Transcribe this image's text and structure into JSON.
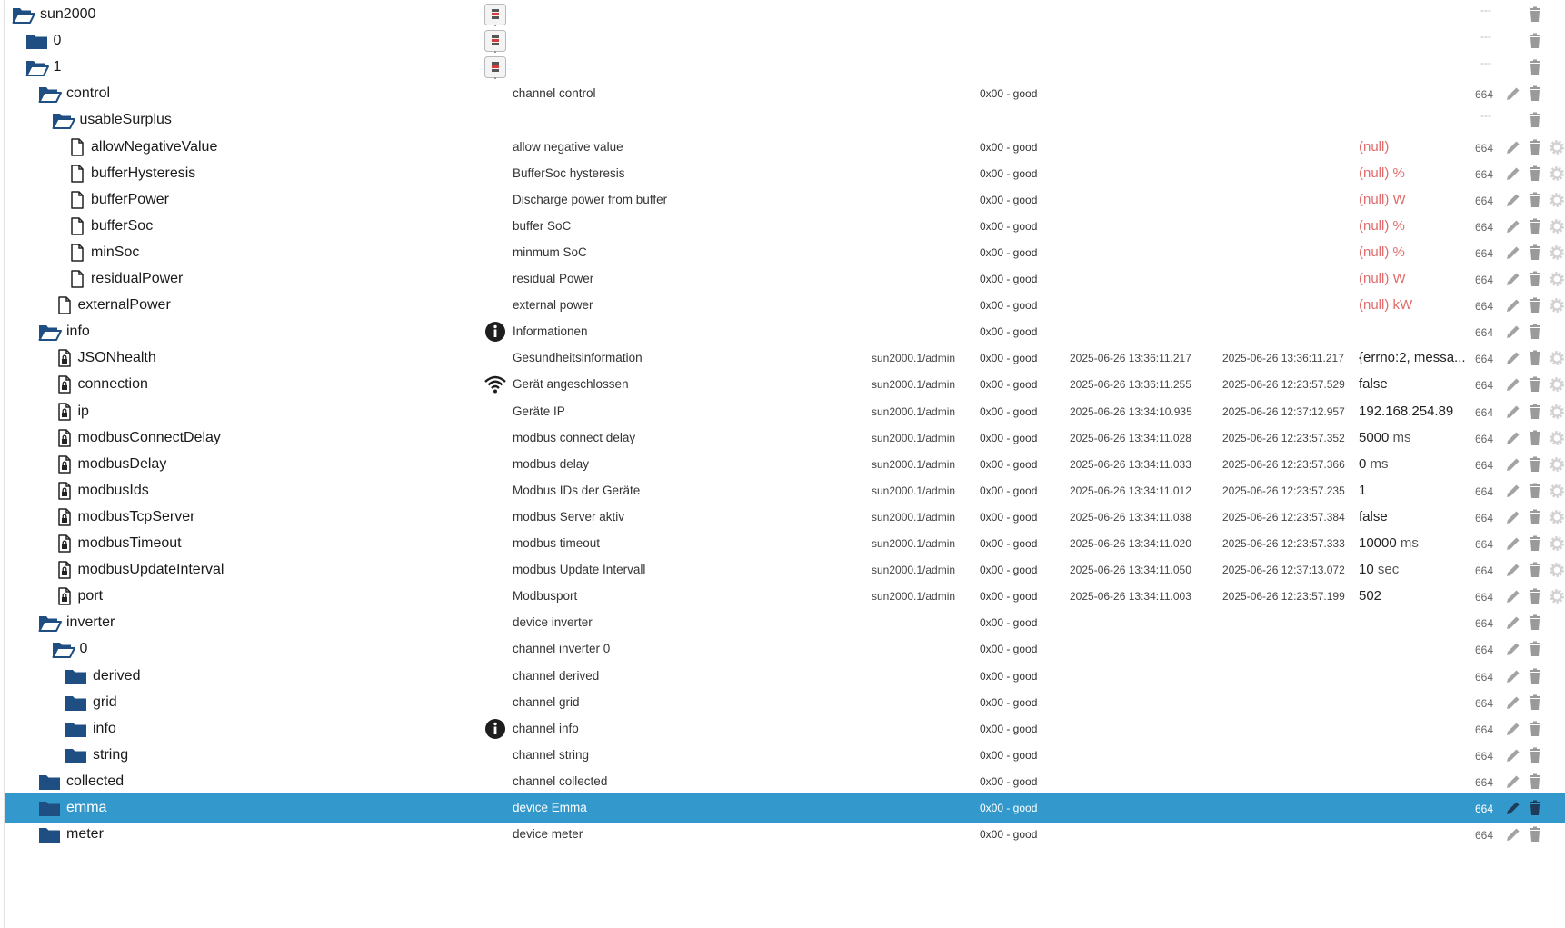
{
  "colors": {
    "folder": "#1f4f82",
    "selection": "#3399cc",
    "null_value": "#e06b6b"
  },
  "rows": [
    {
      "name": "sun2000",
      "indent": 0,
      "type": "folder-open",
      "mid_icon": "device-logo",
      "acl": "---"
    },
    {
      "name": "0",
      "indent": 1,
      "type": "folder",
      "mid_icon": "device-logo",
      "acl": "---"
    },
    {
      "name": "1",
      "indent": 1,
      "type": "folder-open",
      "mid_icon": "device-logo",
      "acl": "---"
    },
    {
      "name": "control",
      "indent": 2,
      "type": "folder-open",
      "desc": "channel control",
      "quality": "0x00 - good",
      "acl": "664"
    },
    {
      "name": "usableSurplus",
      "indent": 3,
      "type": "folder-open",
      "acl": "---"
    },
    {
      "name": "allowNegativeValue",
      "indent": 4,
      "type": "file",
      "desc": "allow negative value",
      "quality": "0x00 - good",
      "value": "(null)",
      "unit": "",
      "acl": "664",
      "gear": true
    },
    {
      "name": "bufferHysteresis",
      "indent": 4,
      "type": "file",
      "desc": "BufferSoc hysteresis",
      "quality": "0x00 - good",
      "value": "(null)",
      "unit": "%",
      "acl": "664",
      "gear": true
    },
    {
      "name": "bufferPower",
      "indent": 4,
      "type": "file",
      "desc": "Discharge power from buffer",
      "quality": "0x00 - good",
      "value": "(null)",
      "unit": "W",
      "acl": "664",
      "gear": true
    },
    {
      "name": "bufferSoc",
      "indent": 4,
      "type": "file",
      "desc": "buffer SoC",
      "quality": "0x00 - good",
      "value": "(null)",
      "unit": "%",
      "acl": "664",
      "gear": true
    },
    {
      "name": "minSoc",
      "indent": 4,
      "type": "file",
      "desc": "minmum SoC",
      "quality": "0x00 - good",
      "value": "(null)",
      "unit": "%",
      "acl": "664",
      "gear": true
    },
    {
      "name": "residualPower",
      "indent": 4,
      "type": "file",
      "desc": "residual Power",
      "quality": "0x00 - good",
      "value": "(null)",
      "unit": "W",
      "acl": "664",
      "gear": true
    },
    {
      "name": "externalPower",
      "indent": 3,
      "type": "file",
      "desc": "external power",
      "quality": "0x00 - good",
      "value": "(null)",
      "unit": "kW",
      "acl": "664",
      "gear": true
    },
    {
      "name": "info",
      "indent": 2,
      "type": "folder-open",
      "mid_icon": "info-icon",
      "desc": "Informationen",
      "quality": "0x00 - good",
      "acl": "664"
    },
    {
      "name": "JSONhealth",
      "indent": 3,
      "type": "file-lock",
      "desc": "Gesundheitsinformation",
      "user": "sun2000.1/admin",
      "quality": "0x00 - good",
      "ts": "2025-06-26 13:36:11.217",
      "lc": "2025-06-26 13:36:11.217",
      "value": "{errno:2, messa...",
      "unit": "",
      "acl": "664",
      "gear": true
    },
    {
      "name": "connection",
      "indent": 3,
      "type": "file-lock",
      "mid_icon": "wifi-icon",
      "desc": "Gerät angeschlossen",
      "user": "sun2000.1/admin",
      "quality": "0x00 - good",
      "ts": "2025-06-26 13:36:11.255",
      "lc": "2025-06-26 12:23:57.529",
      "value": "false",
      "unit": "",
      "acl": "664",
      "gear": true
    },
    {
      "name": "ip",
      "indent": 3,
      "type": "file-lock",
      "desc": "Geräte IP",
      "user": "sun2000.1/admin",
      "quality": "0x00 - good",
      "ts": "2025-06-26 13:34:10.935",
      "lc": "2025-06-26 12:37:12.957",
      "value": "192.168.254.89",
      "unit": "",
      "acl": "664",
      "gear": true
    },
    {
      "name": "modbusConnectDelay",
      "indent": 3,
      "type": "file-lock",
      "desc": "modbus connect delay",
      "user": "sun2000.1/admin",
      "quality": "0x00 - good",
      "ts": "2025-06-26 13:34:11.028",
      "lc": "2025-06-26 12:23:57.352",
      "value": "5000",
      "unit": "ms",
      "acl": "664",
      "gear": true
    },
    {
      "name": "modbusDelay",
      "indent": 3,
      "type": "file-lock",
      "desc": "modbus delay",
      "user": "sun2000.1/admin",
      "quality": "0x00 - good",
      "ts": "2025-06-26 13:34:11.033",
      "lc": "2025-06-26 12:23:57.366",
      "value": "0",
      "unit": "ms",
      "acl": "664",
      "gear": true
    },
    {
      "name": "modbusIds",
      "indent": 3,
      "type": "file-lock",
      "desc": "Modbus IDs der Geräte",
      "user": "sun2000.1/admin",
      "quality": "0x00 - good",
      "ts": "2025-06-26 13:34:11.012",
      "lc": "2025-06-26 12:23:57.235",
      "value": "1",
      "unit": "",
      "acl": "664",
      "gear": true
    },
    {
      "name": "modbusTcpServer",
      "indent": 3,
      "type": "file-lock",
      "desc": "modbus Server aktiv",
      "user": "sun2000.1/admin",
      "quality": "0x00 - good",
      "ts": "2025-06-26 13:34:11.038",
      "lc": "2025-06-26 12:23:57.384",
      "value": "false",
      "unit": "",
      "acl": "664",
      "gear": true
    },
    {
      "name": "modbusTimeout",
      "indent": 3,
      "type": "file-lock",
      "desc": "modbus timeout",
      "user": "sun2000.1/admin",
      "quality": "0x00 - good",
      "ts": "2025-06-26 13:34:11.020",
      "lc": "2025-06-26 12:23:57.333",
      "value": "10000",
      "unit": "ms",
      "acl": "664",
      "gear": true
    },
    {
      "name": "modbusUpdateInterval",
      "indent": 3,
      "type": "file-lock",
      "desc": "modbus Update Intervall",
      "user": "sun2000.1/admin",
      "quality": "0x00 - good",
      "ts": "2025-06-26 13:34:11.050",
      "lc": "2025-06-26 12:37:13.072",
      "value": "10",
      "unit": "sec",
      "acl": "664",
      "gear": true
    },
    {
      "name": "port",
      "indent": 3,
      "type": "file-lock",
      "desc": "Modbusport",
      "user": "sun2000.1/admin",
      "quality": "0x00 - good",
      "ts": "2025-06-26 13:34:11.003",
      "lc": "2025-06-26 12:23:57.199",
      "value": "502",
      "unit": "",
      "acl": "664",
      "gear": true
    },
    {
      "name": "inverter",
      "indent": 2,
      "type": "folder-open",
      "desc": "device inverter",
      "quality": "0x00 - good",
      "acl": "664"
    },
    {
      "name": "0",
      "indent": 3,
      "type": "folder-open",
      "desc": "channel inverter 0",
      "quality": "0x00 - good",
      "acl": "664"
    },
    {
      "name": "derived",
      "indent": 4,
      "type": "folder",
      "desc": "channel derived",
      "quality": "0x00 - good",
      "acl": "664"
    },
    {
      "name": "grid",
      "indent": 4,
      "type": "folder",
      "desc": "channel grid",
      "quality": "0x00 - good",
      "acl": "664"
    },
    {
      "name": "info",
      "indent": 4,
      "type": "folder",
      "mid_icon": "info-icon",
      "desc": "channel info",
      "quality": "0x00 - good",
      "acl": "664"
    },
    {
      "name": "string",
      "indent": 4,
      "type": "folder",
      "desc": "channel string",
      "quality": "0x00 - good",
      "acl": "664"
    },
    {
      "name": "collected",
      "indent": 2,
      "type": "folder",
      "desc": "channel collected",
      "quality": "0x00 - good",
      "acl": "664"
    },
    {
      "name": "emma",
      "indent": 2,
      "type": "folder",
      "desc": "device Emma",
      "quality": "0x00 - good",
      "acl": "664",
      "selected": true
    },
    {
      "name": "meter",
      "indent": 2,
      "type": "folder",
      "desc": "device meter",
      "quality": "0x00 - good",
      "acl": "664"
    }
  ]
}
